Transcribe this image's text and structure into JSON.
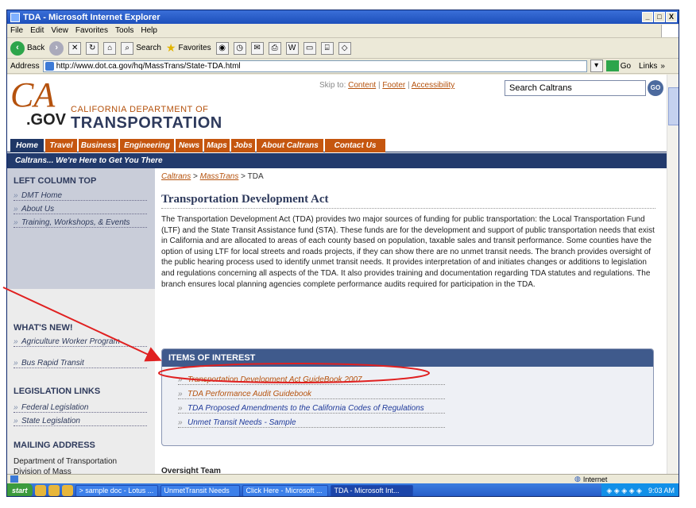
{
  "window": {
    "title": "TDA - Microsoft Internet Explorer",
    "controls": [
      "_",
      "□",
      "X"
    ]
  },
  "menu": [
    "File",
    "Edit",
    "View",
    "Favorites",
    "Tools",
    "Help"
  ],
  "toolbar": {
    "back": "Back",
    "search": "Search",
    "favorites": "Favorites"
  },
  "address": {
    "label": "Address",
    "url": "http://www.dot.ca.gov/hq/MassTrans/State-TDA.html",
    "go": "Go",
    "links": "Links"
  },
  "header": {
    "logo_ca": "CA",
    "logo_gov": ".GOV",
    "dept_line1": "CALIFORNIA DEPARTMENT OF",
    "dept_line2": "TRANSPORTATION",
    "skip_prefix": "Skip to:",
    "skip_links": [
      "Content",
      "Footer",
      "Accessibility"
    ],
    "search_placeholder": "Search Caltrans",
    "search_go": "GO"
  },
  "nav": [
    "Home",
    "Travel",
    "Business",
    "Engineering",
    "News",
    "Maps",
    "Jobs",
    "About Caltrans",
    "Contact Us"
  ],
  "tagline": "Caltrans... We're Here to Get You There",
  "left": {
    "top_heading": "LEFT COLUMN TOP",
    "top_items": [
      "DMT Home",
      "About Us",
      "Training, Workshops, & Events"
    ],
    "whats_new_heading": "WHAT'S NEW!",
    "whats_new_items": [
      "Agriculture Worker Program",
      "Bus Rapid Transit"
    ],
    "legislation_heading": "LEGISLATION LINKS",
    "legislation_items": [
      "Federal Legislation",
      "State Legislation"
    ],
    "mailing_heading": "MAILING ADDRESS",
    "mailing_line1": "Department of Transportation",
    "mailing_line2": "Division of Mass"
  },
  "breadcrumb": {
    "a": "Caltrans",
    "b": "MassTrans",
    "c": "TDA",
    "sep": ">"
  },
  "main": {
    "title": "Transportation Development Act",
    "intro": "The Transportation Development Act (TDA) provides two major sources of funding for public transportation: the Local Transportation Fund (LTF) and the State Transit Assistance fund (STA). These funds are for the development and support of public transportation needs that exist in California and are allocated to areas of each county based on population, taxable sales and transit performance. Some counties have the option of using LTF for local streets and roads projects, if they can show there are no unmet transit needs. The branch provides oversight of the public hearing process used to identify unmet transit needs. It provides interpretation of and initiates changes or additions to legislation and regulations concerning all aspects of the TDA. It also provides training and documentation regarding TDA statutes and regulations. The branch ensures local planning agencies complete performance audits required for participation in the TDA.",
    "ioi_heading": "ITEMS OF INTEREST",
    "ioi_items": [
      "Transportation Development Act GuideBook 2007",
      "TDA Performance Audit Guidebook",
      "TDA Proposed Amendments to the California Codes of Regulations",
      "Unmet Transit Needs - Sample"
    ],
    "oversight": "Oversight Team"
  },
  "status": {
    "zone": "Internet"
  },
  "taskbar": {
    "start": "start",
    "tasks": [
      "> sample doc - Lotus ...",
      "UnmetTransit Needs",
      "Click Here - Microsoft ...",
      "TDA - Microsoft Int..."
    ],
    "clock": "9:03 AM"
  },
  "colors": {
    "caltrans_orange": "#c5560f",
    "navy": "#223a6c",
    "annotation_red": "#e02020"
  }
}
